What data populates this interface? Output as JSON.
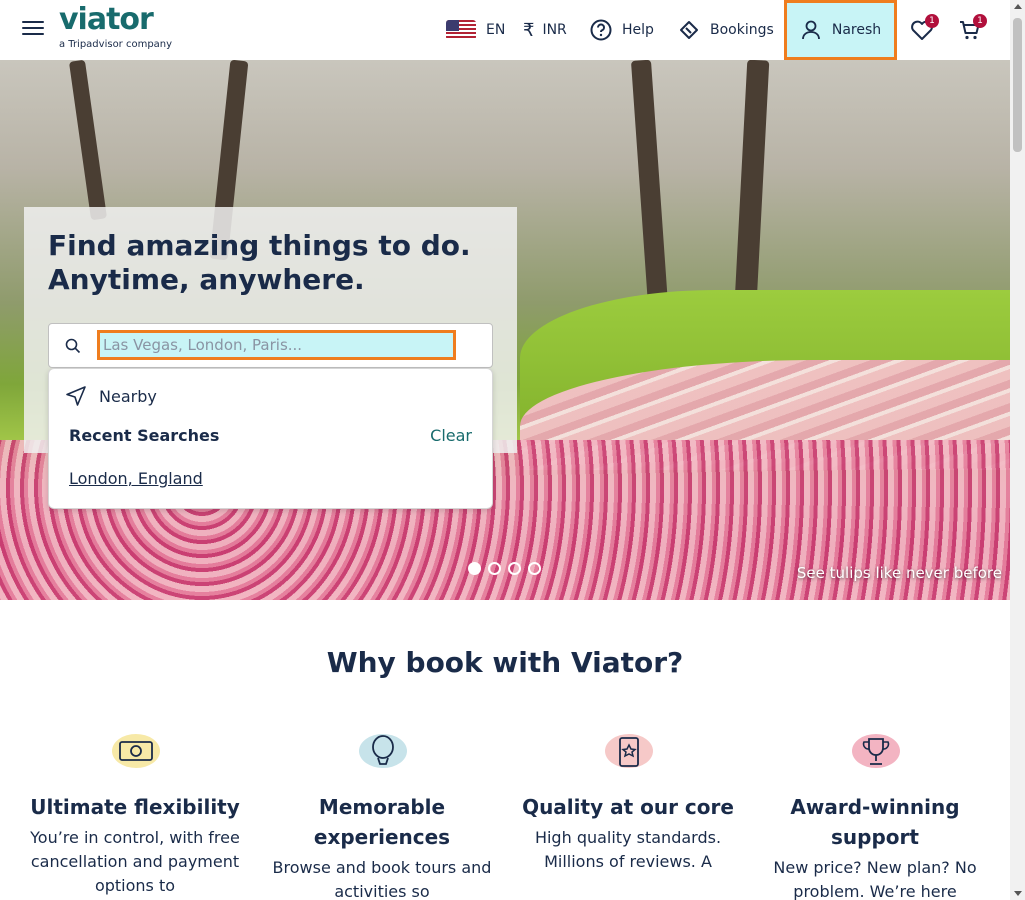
{
  "header": {
    "logo": "viator",
    "logo_sub": "a Tripadvisor company",
    "language": "EN",
    "currency": "INR",
    "help": "Help",
    "bookings": "Bookings",
    "user": "Naresh",
    "wishlist_count": "1",
    "cart_count": "1"
  },
  "hero": {
    "headline": "Find amazing things to do. Anytime, anywhere.",
    "caption": "See tulips like never before",
    "slides_total": 4,
    "active_slide": 1
  },
  "search": {
    "placeholder": "Las Vegas, London, Paris...",
    "value": ""
  },
  "dropdown": {
    "nearby": "Nearby",
    "recent_title": "Recent Searches",
    "clear": "Clear",
    "recent_items": [
      "London, England"
    ]
  },
  "why": {
    "title": "Why book with Viator?",
    "features": [
      {
        "title": "Ultimate flexibility",
        "desc": "You’re in control, with free cancellation and payment options to",
        "icon": "money-icon",
        "color": "#f7e9a7"
      },
      {
        "title": "Memorable experiences",
        "desc": "Browse and book tours and activities so",
        "icon": "balloon-icon",
        "color": "#c7e3ea"
      },
      {
        "title": "Quality at our core",
        "desc": "High quality standards. Millions of reviews. A",
        "icon": "badge-icon",
        "color": "#f6c9c8"
      },
      {
        "title": "Award-winning support",
        "desc": "New price? New plan? No problem. We’re here",
        "icon": "trophy-icon",
        "color": "#f3b4c2"
      }
    ]
  }
}
